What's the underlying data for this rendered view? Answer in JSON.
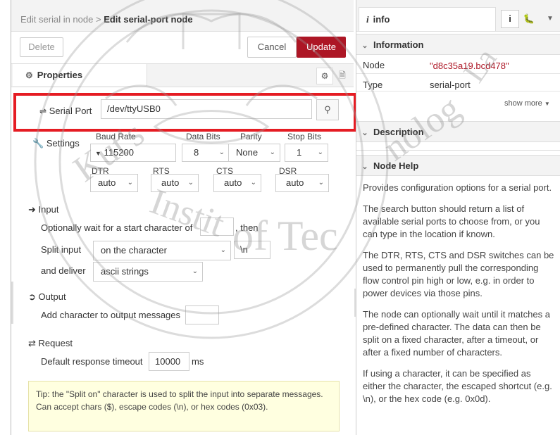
{
  "editor": {
    "breadcrumb_parent": "Edit serial in node",
    "breadcrumb_sep": ">",
    "breadcrumb_current": "Edit serial-port node",
    "buttons": {
      "delete": "Delete",
      "cancel": "Cancel",
      "update": "Update"
    },
    "tab_properties": "Properties",
    "serial_port": {
      "label": "Serial Port",
      "value": "/dev/ttyUSB0"
    },
    "settings": {
      "label": "Settings",
      "columns": [
        "Baud Rate",
        "Data Bits",
        "Parity",
        "Stop Bits"
      ],
      "baud_rate": "115200",
      "data_bits": "8",
      "parity": "None",
      "stop_bits": "1",
      "pins": [
        {
          "label": "DTR",
          "value": "auto"
        },
        {
          "label": "RTS",
          "value": "auto"
        },
        {
          "label": "CTS",
          "value": "auto"
        },
        {
          "label": "DSR",
          "value": "auto"
        }
      ]
    },
    "input": {
      "heading": "Input",
      "wait_prefix": "Optionally wait for a start character of",
      "wait_value": "",
      "wait_suffix": ", then",
      "split_label": "Split input",
      "split_mode": "on the character",
      "split_value": "\\n",
      "deliver_label": "and deliver",
      "deliver_value": "ascii strings"
    },
    "output": {
      "heading": "Output",
      "add_char_label": "Add character to output messages",
      "add_char_value": ""
    },
    "request": {
      "heading": "Request",
      "timeout_label": "Default response timeout",
      "timeout_value": "10000",
      "timeout_unit": "ms"
    },
    "tip": "Tip: the \"Split on\" character is used to split the input into separate messages. Can accept chars ($), escape codes (\\n), or hex codes (0x03)."
  },
  "info": {
    "tab_label": "info",
    "tab_icon_info": "i",
    "sections": {
      "information": "Information",
      "description": "Description",
      "node_help": "Node Help"
    },
    "node_label": "Node",
    "node_value": "\"d8c35a19.bcd478\"",
    "type_label": "Type",
    "type_value": "serial-port",
    "show_more": "show more",
    "help_paragraphs": [
      "Provides configuration options for a serial port.",
      "The search button should return a list of available serial ports to choose from, or you can type in the location if known.",
      "The DTR, RTS, CTS and DSR switches can be used to permanently pull the corresponding flow control pin high or low, e.g. in order to power devices via those pins.",
      "The node can optionally wait until it matches a pre-defined character. The data can then be split on a fixed character, after a timeout, or after a fixed number of characters.",
      "If using a character, it can be specified as either the character, the escaped shortcut (e.g. \\n), or the hex code (e.g. 0x0d)."
    ]
  },
  "watermark": {
    "text": "Rajamangala University of Technology Lanna King Mongkut's Institute of Technology"
  },
  "colors": {
    "accent": "#ad1625",
    "highlight": "#e51c23",
    "node_id": "#ad1625",
    "tip_bg": "#ffffe0"
  },
  "icons": [
    "shuffle-icon",
    "wrench-icon",
    "search-icon",
    "gear-icon",
    "file-icon",
    "sign-in-icon",
    "sign-out-icon",
    "exchange-icon",
    "bug-icon",
    "chevron-down-icon",
    "info-icon"
  ]
}
